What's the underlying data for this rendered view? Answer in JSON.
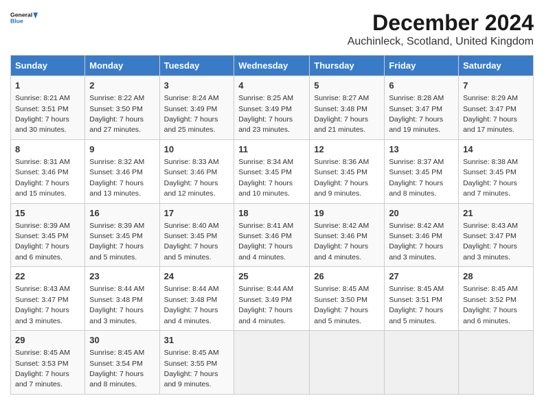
{
  "header": {
    "logo_general": "General",
    "logo_blue": "Blue",
    "title": "December 2024",
    "subtitle": "Auchinleck, Scotland, United Kingdom"
  },
  "calendar": {
    "days_of_week": [
      "Sunday",
      "Monday",
      "Tuesday",
      "Wednesday",
      "Thursday",
      "Friday",
      "Saturday"
    ],
    "weeks": [
      [
        {
          "day": "1",
          "sunrise": "8:21 AM",
          "sunset": "3:51 PM",
          "daylight": "7 hours and 30 minutes."
        },
        {
          "day": "2",
          "sunrise": "8:22 AM",
          "sunset": "3:50 PM",
          "daylight": "7 hours and 27 minutes."
        },
        {
          "day": "3",
          "sunrise": "8:24 AM",
          "sunset": "3:49 PM",
          "daylight": "7 hours and 25 minutes."
        },
        {
          "day": "4",
          "sunrise": "8:25 AM",
          "sunset": "3:49 PM",
          "daylight": "7 hours and 23 minutes."
        },
        {
          "day": "5",
          "sunrise": "8:27 AM",
          "sunset": "3:48 PM",
          "daylight": "7 hours and 21 minutes."
        },
        {
          "day": "6",
          "sunrise": "8:28 AM",
          "sunset": "3:47 PM",
          "daylight": "7 hours and 19 minutes."
        },
        {
          "day": "7",
          "sunrise": "8:29 AM",
          "sunset": "3:47 PM",
          "daylight": "7 hours and 17 minutes."
        }
      ],
      [
        {
          "day": "8",
          "sunrise": "8:31 AM",
          "sunset": "3:46 PM",
          "daylight": "7 hours and 15 minutes."
        },
        {
          "day": "9",
          "sunrise": "8:32 AM",
          "sunset": "3:46 PM",
          "daylight": "7 hours and 13 minutes."
        },
        {
          "day": "10",
          "sunrise": "8:33 AM",
          "sunset": "3:46 PM",
          "daylight": "7 hours and 12 minutes."
        },
        {
          "day": "11",
          "sunrise": "8:34 AM",
          "sunset": "3:45 PM",
          "daylight": "7 hours and 10 minutes."
        },
        {
          "day": "12",
          "sunrise": "8:36 AM",
          "sunset": "3:45 PM",
          "daylight": "7 hours and 9 minutes."
        },
        {
          "day": "13",
          "sunrise": "8:37 AM",
          "sunset": "3:45 PM",
          "daylight": "7 hours and 8 minutes."
        },
        {
          "day": "14",
          "sunrise": "8:38 AM",
          "sunset": "3:45 PM",
          "daylight": "7 hours and 7 minutes."
        }
      ],
      [
        {
          "day": "15",
          "sunrise": "8:39 AM",
          "sunset": "3:45 PM",
          "daylight": "7 hours and 6 minutes."
        },
        {
          "day": "16",
          "sunrise": "8:39 AM",
          "sunset": "3:45 PM",
          "daylight": "7 hours and 5 minutes."
        },
        {
          "day": "17",
          "sunrise": "8:40 AM",
          "sunset": "3:45 PM",
          "daylight": "7 hours and 5 minutes."
        },
        {
          "day": "18",
          "sunrise": "8:41 AM",
          "sunset": "3:46 PM",
          "daylight": "7 hours and 4 minutes."
        },
        {
          "day": "19",
          "sunrise": "8:42 AM",
          "sunset": "3:46 PM",
          "daylight": "7 hours and 4 minutes."
        },
        {
          "day": "20",
          "sunrise": "8:42 AM",
          "sunset": "3:46 PM",
          "daylight": "7 hours and 3 minutes."
        },
        {
          "day": "21",
          "sunrise": "8:43 AM",
          "sunset": "3:47 PM",
          "daylight": "7 hours and 3 minutes."
        }
      ],
      [
        {
          "day": "22",
          "sunrise": "8:43 AM",
          "sunset": "3:47 PM",
          "daylight": "7 hours and 3 minutes."
        },
        {
          "day": "23",
          "sunrise": "8:44 AM",
          "sunset": "3:48 PM",
          "daylight": "7 hours and 3 minutes."
        },
        {
          "day": "24",
          "sunrise": "8:44 AM",
          "sunset": "3:48 PM",
          "daylight": "7 hours and 4 minutes."
        },
        {
          "day": "25",
          "sunrise": "8:44 AM",
          "sunset": "3:49 PM",
          "daylight": "7 hours and 4 minutes."
        },
        {
          "day": "26",
          "sunrise": "8:45 AM",
          "sunset": "3:50 PM",
          "daylight": "7 hours and 5 minutes."
        },
        {
          "day": "27",
          "sunrise": "8:45 AM",
          "sunset": "3:51 PM",
          "daylight": "7 hours and 5 minutes."
        },
        {
          "day": "28",
          "sunrise": "8:45 AM",
          "sunset": "3:52 PM",
          "daylight": "7 hours and 6 minutes."
        }
      ],
      [
        {
          "day": "29",
          "sunrise": "8:45 AM",
          "sunset": "3:53 PM",
          "daylight": "7 hours and 7 minutes."
        },
        {
          "day": "30",
          "sunrise": "8:45 AM",
          "sunset": "3:54 PM",
          "daylight": "7 hours and 8 minutes."
        },
        {
          "day": "31",
          "sunrise": "8:45 AM",
          "sunset": "3:55 PM",
          "daylight": "7 hours and 9 minutes."
        },
        null,
        null,
        null,
        null
      ]
    ]
  }
}
